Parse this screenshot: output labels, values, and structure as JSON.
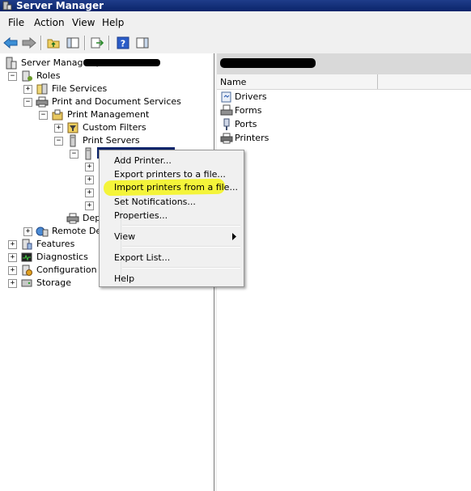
{
  "window": {
    "title": "Server Manager"
  },
  "menu": {
    "items": [
      "File",
      "Action",
      "View",
      "Help"
    ]
  },
  "toolbar": {
    "icons": [
      "back-arrow-icon",
      "forward-arrow-icon",
      "up-folder-icon",
      "show-hide-tree-icon",
      "export-list-icon",
      "help-icon",
      "show-action-pane-icon"
    ]
  },
  "tree": {
    "root": "Server Manager (",
    "roles": "Roles",
    "file_services": "File Services",
    "print_doc_services": "Print and Document Services",
    "print_management": "Print Management",
    "custom_filters": "Custom Filters",
    "print_servers": "Print Servers",
    "dep": "Dep",
    "remote_des": "Remote Des",
    "features": "Features",
    "diagnostics": "Diagnostics",
    "configuration": "Configuration",
    "storage": "Storage",
    "exp_minus": "−",
    "exp_plus": "+"
  },
  "context_menu": {
    "add_printer": "Add Printer...",
    "export_printers": "Export printers to a file...",
    "import_printers": "Import printers from a file...",
    "set_notifications": "Set Notifications...",
    "properties": "Properties...",
    "view": "View",
    "export_list": "Export List...",
    "help": "Help"
  },
  "list": {
    "column_name": "Name",
    "items": [
      "Drivers",
      "Forms",
      "Ports",
      "Printers"
    ]
  },
  "colors": {
    "highlight": "#f5f51a",
    "titlebar": "#0a246a",
    "selection": "#0a246a"
  }
}
